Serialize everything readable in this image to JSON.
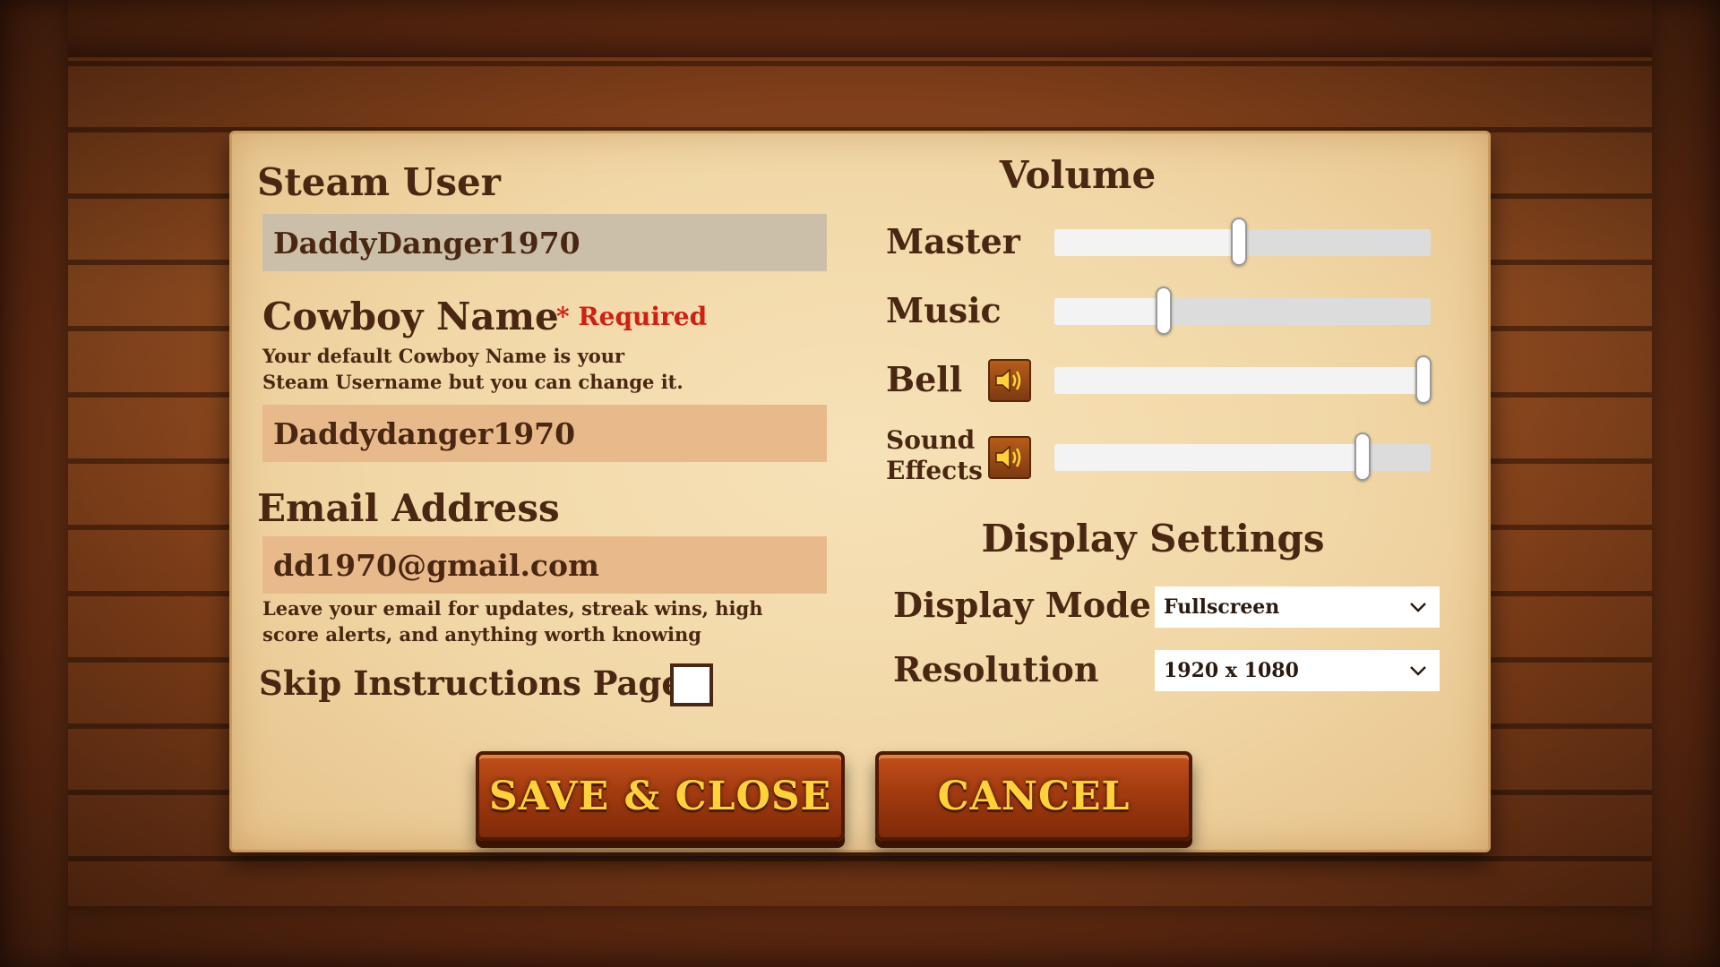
{
  "left": {
    "steam_user": {
      "label": "Steam User",
      "value": "DaddyDanger1970"
    },
    "cowboy_name": {
      "label": "Cowboy Name",
      "required_text": "* Required",
      "help_line1": "Your default Cowboy Name is your",
      "help_line2": "Steam Username but you can change it.",
      "value": "Daddydanger1970"
    },
    "email": {
      "label": "Email Address",
      "value": "dd1970@gmail.com",
      "help_line1": "Leave your email for updates, streak wins, high",
      "help_line2": "score alerts, and anything worth knowing"
    },
    "skip_instructions": {
      "label": "Skip Instructions Page",
      "checked": false
    }
  },
  "volume": {
    "title": "Volume",
    "sliders": [
      {
        "label": "Master",
        "value": 0.49,
        "has_speaker": false
      },
      {
        "label": "Music",
        "value": 0.29,
        "has_speaker": false
      },
      {
        "label": "Bell",
        "value": 0.98,
        "has_speaker": true
      },
      {
        "label_line1": "Sound",
        "label_line2": "Effects",
        "value": 0.82,
        "has_speaker": true
      }
    ]
  },
  "display": {
    "title": "Display Settings",
    "mode": {
      "label": "Display Mode",
      "value": "Fullscreen"
    },
    "resolution": {
      "label": "Resolution",
      "value": "1920 x 1080"
    }
  },
  "buttons": {
    "save": "SAVE & CLOSE",
    "cancel": "CANCEL"
  },
  "colors": {
    "text": "#4a2712",
    "required": "#d11f12",
    "button_text": "#ffd23a"
  },
  "icons": {
    "speaker": "speaker-icon",
    "dropdown": "chevron-down-icon"
  }
}
